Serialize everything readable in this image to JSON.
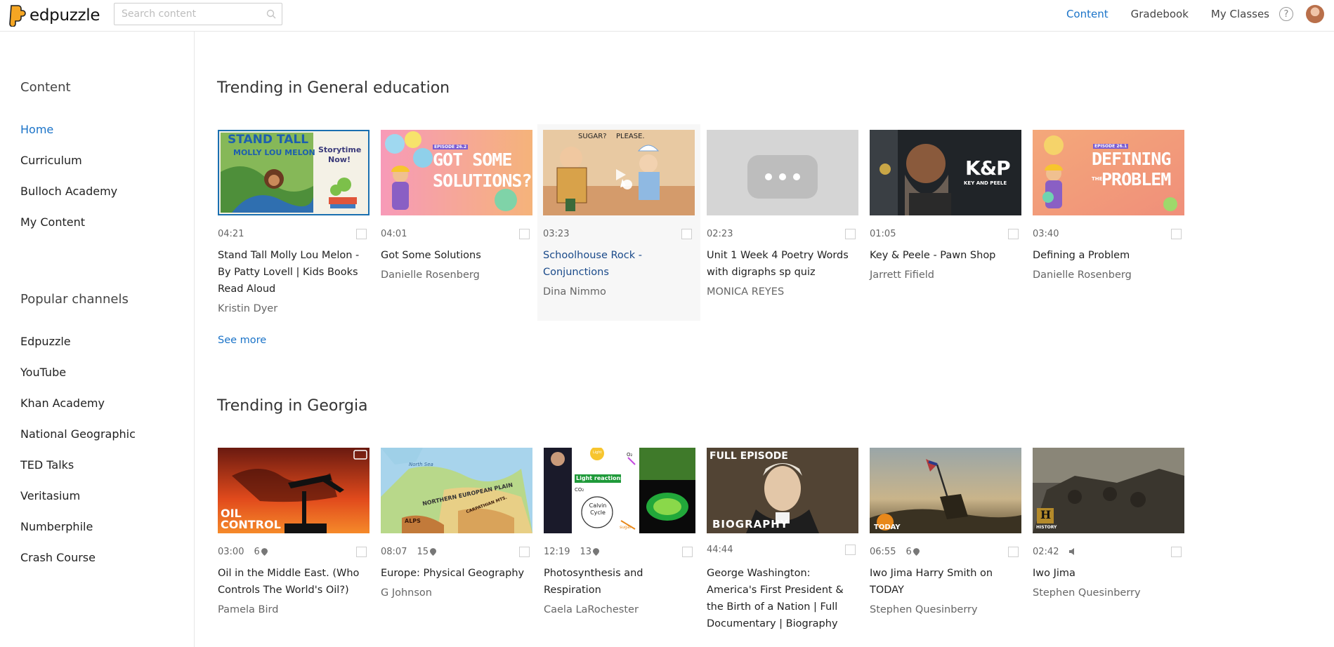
{
  "app": {
    "name": "edpuzzle"
  },
  "search": {
    "placeholder": "Search content"
  },
  "nav": {
    "content": "Content",
    "gradebook": "Gradebook",
    "my_classes": "My Classes",
    "help": "?"
  },
  "sidebar": {
    "content_heading": "Content",
    "content_items": [
      "Home",
      "Curriculum",
      "Bulloch Academy",
      "My Content"
    ],
    "channels_heading": "Popular channels",
    "channel_items": [
      "Edpuzzle",
      "YouTube",
      "Khan Academy",
      "National Geographic",
      "TED Talks",
      "Veritasium",
      "Numberphile",
      "Crash Course"
    ]
  },
  "sections": [
    {
      "title": "Trending in General education",
      "see_more": "See more",
      "videos": [
        {
          "duration": "04:21",
          "title": "Stand Tall Molly Lou Melon - By Patty Lovell | Kids Books Read Aloud",
          "author": "Kristin Dyer",
          "thumb_text": [
            "STAND TALL",
            "MOLLY LOU MELON",
            "Storytime Now!"
          ]
        },
        {
          "duration": "04:01",
          "title": "Got Some Solutions",
          "author": "Danielle Rosenberg",
          "thumb_text": [
            "EPISODE 26.2",
            "GOT SOME",
            "SOLUTIONS?"
          ]
        },
        {
          "duration": "03:23",
          "title": "Schoolhouse Rock - Conjunctions",
          "author": "Dina Nimmo",
          "thumb_text": [
            "SUGAR?",
            "PLEASE."
          ]
        },
        {
          "duration": "02:23",
          "title": "Unit 1 Week 4 Poetry Words with digraphs sp quiz",
          "author": "MONICA REYES"
        },
        {
          "duration": "01:05",
          "title": "Key & Peele - Pawn Shop",
          "author": "Jarrett Fifield",
          "thumb_text": [
            "K&P",
            "KEY AND PEELE"
          ]
        },
        {
          "duration": "03:40",
          "title": "Defining a Problem",
          "author": "Danielle Rosenberg",
          "thumb_text": [
            "EPISODE 26.1",
            "DEFINING",
            "THE",
            "PROBLEM"
          ]
        }
      ]
    },
    {
      "title": "Trending in Georgia",
      "videos": [
        {
          "duration": "03:00",
          "pins": "6",
          "title": "Oil in the Middle East. (Who Controls The World's Oil?)",
          "author": "Pamela Bird",
          "thumb_text": [
            "OIL",
            "CONTROL"
          ]
        },
        {
          "duration": "08:07",
          "pins": "15",
          "title": "Europe: Physical Geography",
          "author": "G Johnson",
          "thumb_text": [
            "NORTHERN EUROPEAN PLAIN",
            "North Sea",
            "ALPS",
            "CARPATHIAN MTS."
          ]
        },
        {
          "duration": "12:19",
          "pins": "13",
          "title": "Photosynthesis and Respiration",
          "author": "Caela LaRochester",
          "thumb_text": [
            "Light",
            "Light reactions",
            "Calvin Cycle",
            "sugar",
            "CO₂",
            "O₂"
          ]
        },
        {
          "duration": "44:44",
          "title": "George Washington: America's First President & the Birth of a Nation | Full Documentary | Biography",
          "author": "",
          "thumb_text": [
            "FULL EPISODE",
            "BIOGRAPHY"
          ]
        },
        {
          "duration": "06:55",
          "pins": "6",
          "title": "Iwo Jima Harry Smith on TODAY",
          "author": "Stephen Quesinberry",
          "thumb_text": [
            "TODAY"
          ]
        },
        {
          "duration": "02:42",
          "sound": true,
          "title": "Iwo Jima",
          "author": "Stephen Quesinberry",
          "thumb_text": [
            "H",
            "HISTORY"
          ]
        }
      ]
    }
  ],
  "colors": {
    "accent": "#1a73c8",
    "logo": "#f5a623"
  }
}
